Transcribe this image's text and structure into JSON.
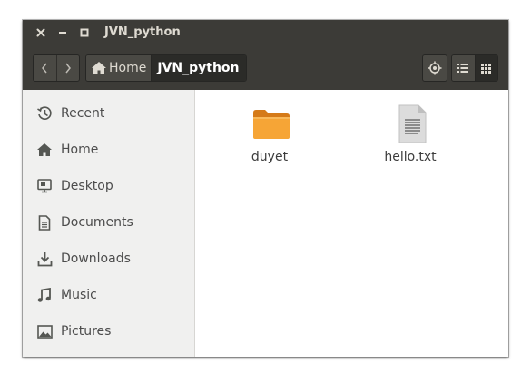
{
  "window": {
    "title": "JVN_python",
    "controls": [
      "close-icon",
      "minimize-icon",
      "maximize-icon"
    ]
  },
  "toolbar": {
    "back_icon": "chevron-left-icon",
    "forward_icon": "chevron-right-icon",
    "breadcrumb": {
      "home_label": "Home",
      "current_label": "JVN_python"
    },
    "locate_icon": "crosshair-icon",
    "view_modes": [
      "list-view-icon",
      "grid-view-icon"
    ],
    "active_view": "grid-view-icon"
  },
  "sidebar": {
    "items": [
      {
        "label": "Recent",
        "icon": "clock-icon"
      },
      {
        "label": "Home",
        "icon": "home-icon"
      },
      {
        "label": "Desktop",
        "icon": "desktop-icon"
      },
      {
        "label": "Documents",
        "icon": "document-icon"
      },
      {
        "label": "Downloads",
        "icon": "download-icon"
      },
      {
        "label": "Music",
        "icon": "music-icon"
      },
      {
        "label": "Pictures",
        "icon": "picture-icon"
      }
    ]
  },
  "files": [
    {
      "name": "duyet",
      "type": "folder",
      "icon": "folder-icon"
    },
    {
      "name": "hello.txt",
      "type": "text",
      "icon": "text-file-icon"
    }
  ],
  "colors": {
    "header": "#3c3b37",
    "sidebar": "#f0f0ef",
    "folder": "#f6a536",
    "accent_text": "#dfdbd2"
  }
}
